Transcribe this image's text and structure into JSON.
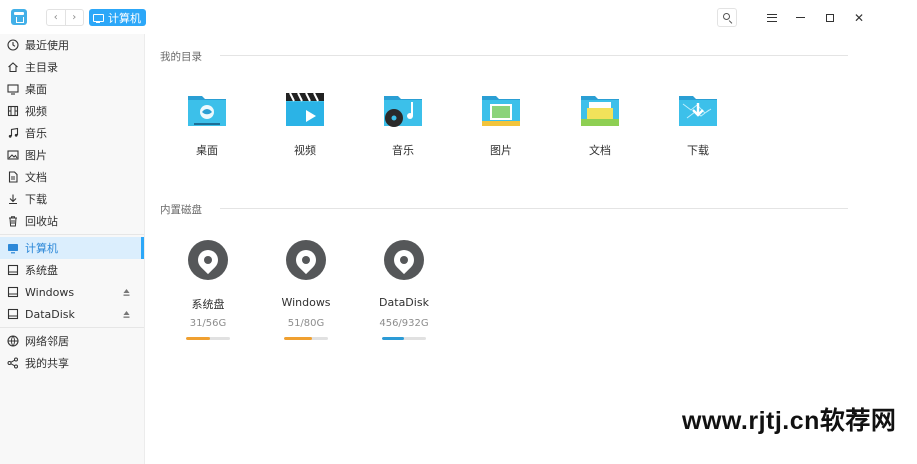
{
  "breadcrumb": {
    "label": "计算机"
  },
  "nav": {
    "back": "‹",
    "forward": "›"
  },
  "window_controls": {
    "close": "✕"
  },
  "sidebar": {
    "items": [
      {
        "label": "最近使用",
        "icon": "clock-icon"
      },
      {
        "label": "主目录",
        "icon": "home-icon"
      },
      {
        "label": "桌面",
        "icon": "desktop-icon"
      },
      {
        "label": "视频",
        "icon": "film-icon"
      },
      {
        "label": "音乐",
        "icon": "music-icon"
      },
      {
        "label": "图片",
        "icon": "image-icon"
      },
      {
        "label": "文档",
        "icon": "document-icon"
      },
      {
        "label": "下载",
        "icon": "download-icon"
      },
      {
        "label": "回收站",
        "icon": "trash-icon"
      }
    ],
    "devices": [
      {
        "label": "计算机",
        "icon": "computer-icon",
        "active": true
      },
      {
        "label": "系统盘",
        "icon": "drive-icon"
      },
      {
        "label": "Windows",
        "icon": "drive-icon",
        "ejectable": true
      },
      {
        "label": "DataDisk",
        "icon": "drive-icon",
        "ejectable": true
      }
    ],
    "network": [
      {
        "label": "网络邻居",
        "icon": "network-icon"
      },
      {
        "label": "我的共享",
        "icon": "share-icon"
      }
    ]
  },
  "main": {
    "my_dirs_title": "我的目录",
    "folders": [
      {
        "label": "桌面",
        "icon": "desktop-folder-icon"
      },
      {
        "label": "视频",
        "icon": "video-folder-icon"
      },
      {
        "label": "音乐",
        "icon": "music-folder-icon"
      },
      {
        "label": "图片",
        "icon": "pictures-folder-icon"
      },
      {
        "label": "文档",
        "icon": "documents-folder-icon"
      },
      {
        "label": "下载",
        "icon": "downloads-folder-icon"
      }
    ],
    "disks_title": "内置磁盘",
    "disks": [
      {
        "name": "系统盘",
        "size": "31/56G",
        "usage": 0.55,
        "color": "#f0a030"
      },
      {
        "name": "Windows",
        "size": "51/80G",
        "usage": 0.64,
        "color": "#f0a030"
      },
      {
        "name": "DataDisk",
        "size": "456/932G",
        "usage": 0.49,
        "color": "#2c9bd6"
      }
    ]
  },
  "watermark": "www.rjtj.cn软荐网",
  "colors": {
    "accent": "#2ca7f8",
    "folder": "#35b7e8",
    "disk": "#555759"
  }
}
